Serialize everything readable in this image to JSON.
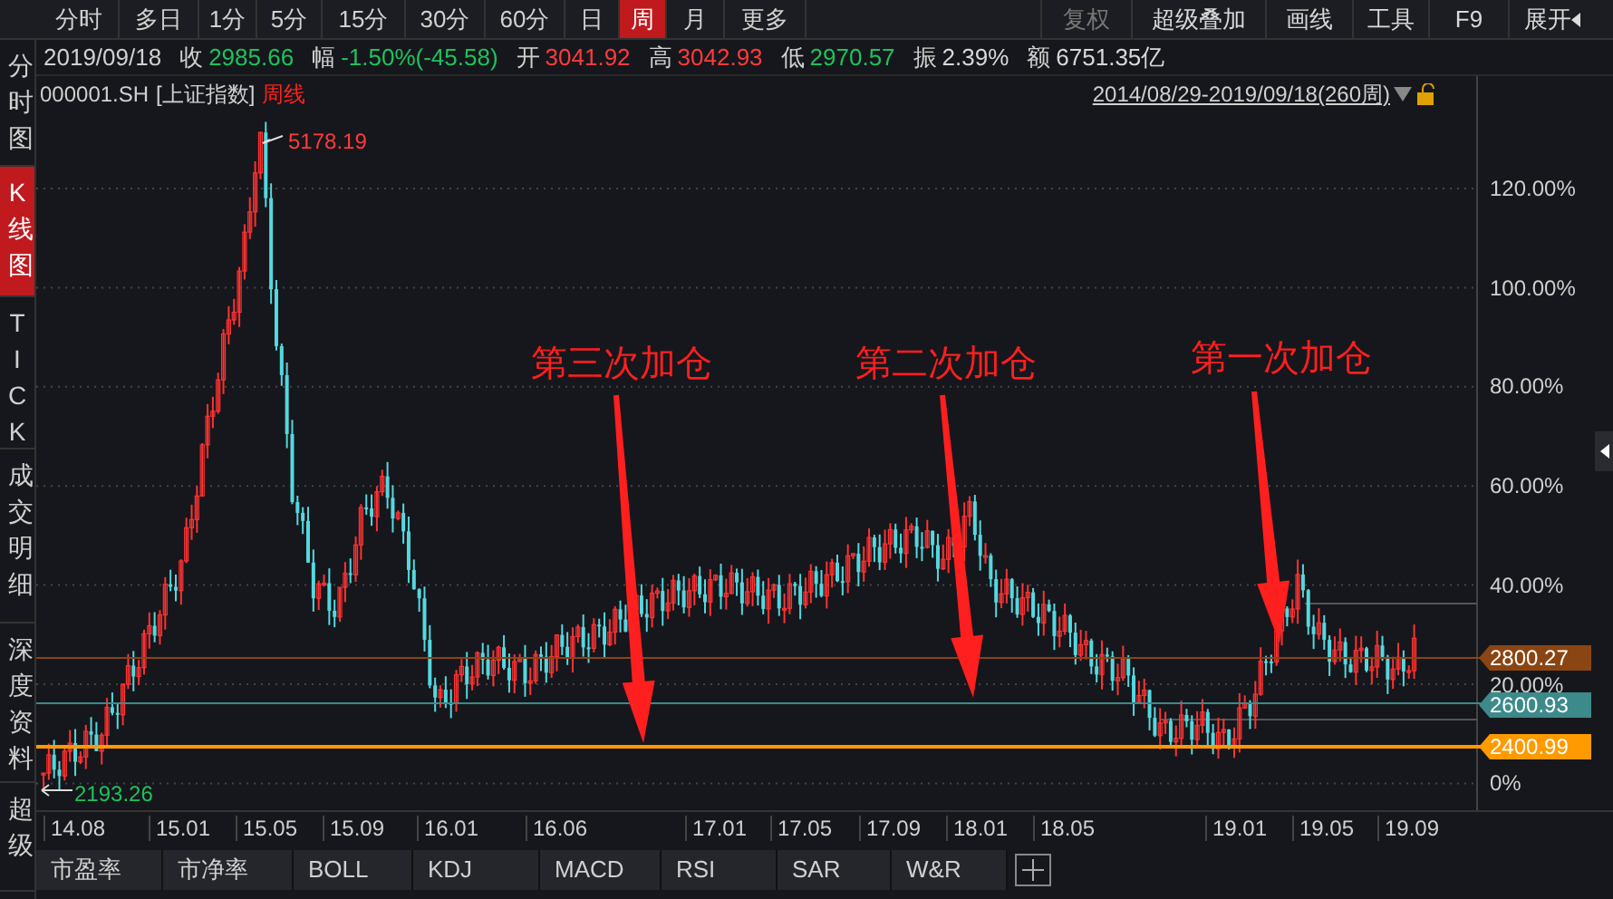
{
  "toolbar": {
    "periods": [
      {
        "label": "分时",
        "selected": false
      },
      {
        "label": "多日",
        "selected": false
      },
      {
        "label": "1分",
        "selected": false
      },
      {
        "label": "5分",
        "selected": false
      },
      {
        "label": "15分",
        "selected": false
      },
      {
        "label": "30分",
        "selected": false
      },
      {
        "label": "60分",
        "selected": false
      },
      {
        "label": "日",
        "selected": false
      },
      {
        "label": "周",
        "selected": true
      },
      {
        "label": "月",
        "selected": false
      },
      {
        "label": "更多",
        "selected": false
      }
    ],
    "tools": [
      {
        "label": "复权",
        "disabled": true
      },
      {
        "label": "超级叠加",
        "disabled": false
      },
      {
        "label": "画线",
        "disabled": false
      },
      {
        "label": "工具",
        "disabled": false
      },
      {
        "label": "F9",
        "disabled": false
      },
      {
        "label": "展开",
        "disabled": false
      }
    ]
  },
  "quote": {
    "date": "2019/09/18",
    "fields": [
      {
        "label": "收",
        "value": "2985.66",
        "color": "#1ec25c"
      },
      {
        "label": "幅",
        "value": "-1.50%(-45.58)",
        "color": "#1ec25c"
      },
      {
        "label": "开",
        "value": "3041.92",
        "color": "#ff3b3b"
      },
      {
        "label": "高",
        "value": "3042.93",
        "color": "#ff3b3b"
      },
      {
        "label": "低",
        "value": "2970.57",
        "color": "#1ec25c"
      },
      {
        "label": "振",
        "value": "2.39%",
        "color": "#d8d8d8"
      },
      {
        "label": "额",
        "value": "6751.35亿",
        "color": "#d8d8d8"
      }
    ]
  },
  "sidebar": {
    "items": [
      {
        "label": "分时图",
        "selected": false
      },
      {
        "label": "K线图",
        "selected": true
      },
      {
        "label": "TICK",
        "selected": false
      },
      {
        "label": "成交明细",
        "selected": false
      },
      {
        "label": "深度资料",
        "selected": false
      },
      {
        "label": "超级",
        "selected": false
      }
    ]
  },
  "chart": {
    "symbol": "000001.SH",
    "name": "[上证指数]",
    "period": "周线",
    "date_range": "2014/08/29-2019/09/18(260周)",
    "high_label": "5178.19",
    "low_label": "2193.26",
    "percent_ticks": [
      "120.00%",
      "100.00%",
      "80.00%",
      "60.00%",
      "40.00%",
      "20.00%",
      "0%"
    ],
    "price_lines": [
      {
        "label": "2800.27",
        "color": "#8b4513"
      },
      {
        "label": "2600.93",
        "color": "#3d8a8a"
      },
      {
        "label": "2400.99",
        "color": "#ff9a00"
      }
    ],
    "annotations": [
      {
        "text": "第三次加仓"
      },
      {
        "text": "第二次加仓"
      },
      {
        "text": "第一次加仓"
      }
    ],
    "date_ticks": [
      "14.08",
      "15.01",
      "15.05",
      "15.09",
      "16.01",
      "16.06",
      "17.01",
      "17.05",
      "17.09",
      "18.01",
      "18.05",
      "19.01",
      "19.05",
      "19.09"
    ]
  },
  "indicator_tabs": [
    {
      "label": "市盈率"
    },
    {
      "label": "市净率"
    },
    {
      "label": "BOLL"
    },
    {
      "label": "KDJ"
    },
    {
      "label": "MACD"
    },
    {
      "label": "RSI"
    },
    {
      "label": "SAR"
    },
    {
      "label": "W&R"
    }
  ]
}
